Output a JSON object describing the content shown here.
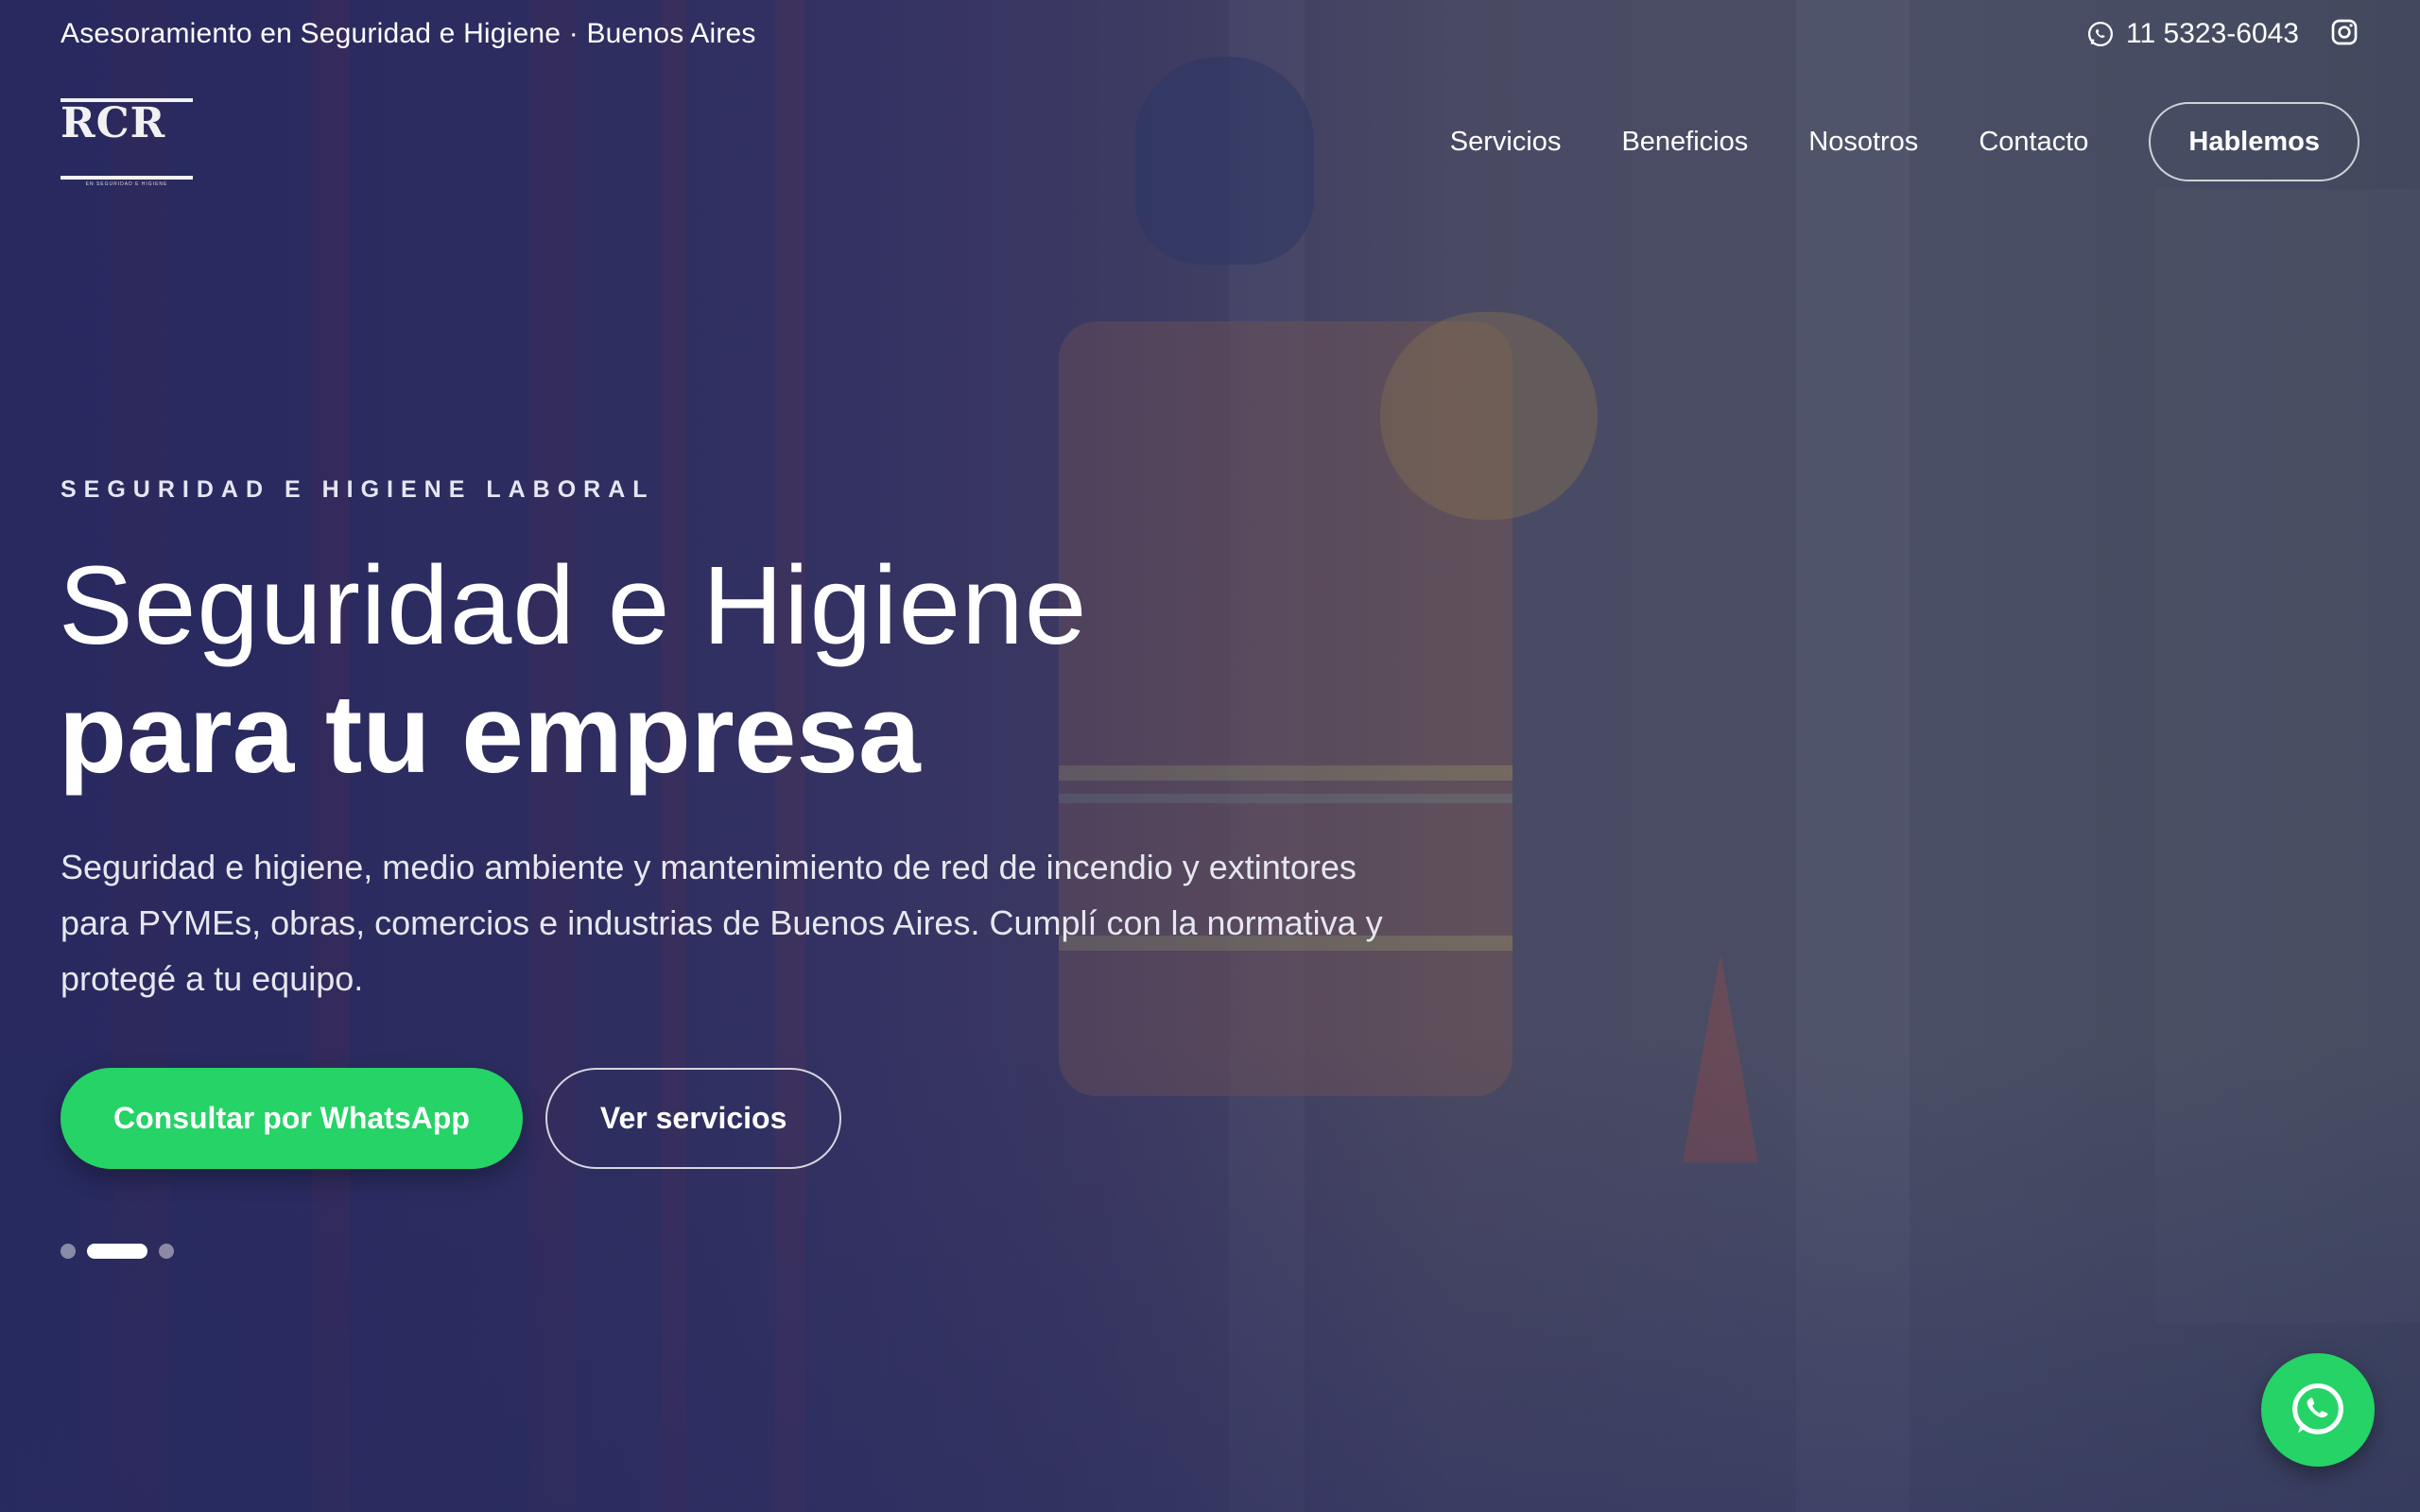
{
  "topbar": {
    "tagline": "Asesoramiento en Seguridad e Higiene · Buenos Aires",
    "phone": "11 5323-6043",
    "whatsapp_icon": "whatsapp-icon",
    "instagram_icon": "instagram-icon"
  },
  "header": {
    "logo_text": "RCR",
    "logo_tagline": "EN SEGURIDAD E HIGIENE",
    "nav": [
      "Servicios",
      "Beneficios",
      "Nosotros",
      "Contacto"
    ],
    "cta": "Hablemos"
  },
  "hero": {
    "eyebrow": "SEGURIDAD E HIGIENE LABORAL",
    "title_light": "Seguridad e Higiene",
    "title_bold": "para tu empresa",
    "lead": "Seguridad e higiene, medio ambiente y mantenimiento de red de incendio y extintores para PYMEs, obras, comercios e industrias de Buenos Aires. Cumplí con la normativa y protegé a tu equipo.",
    "primary_button": "Consultar por WhatsApp",
    "secondary_button": "Ver servicios",
    "slides_total": 3,
    "slide_active": 2
  },
  "floating": {
    "whatsapp_icon": "whatsapp-icon"
  },
  "colors": {
    "accent_green": "#25d366",
    "overlay_navy": "#2b2f5a",
    "text": "#ffffff"
  }
}
